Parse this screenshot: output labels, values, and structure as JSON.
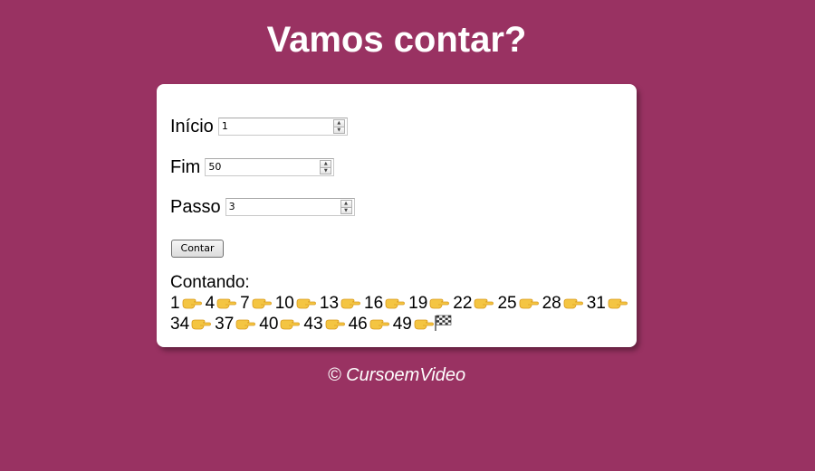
{
  "title": "Vamos contar?",
  "form": {
    "inicio": {
      "label": "Início",
      "value": "1"
    },
    "fim": {
      "label": "Fim",
      "value": "50"
    },
    "passo": {
      "label": "Passo",
      "value": "3"
    },
    "button_label": "Contar"
  },
  "result": {
    "heading": "Contando:",
    "numbers": [
      "1",
      "4",
      "7",
      "10",
      "13",
      "16",
      "19",
      "22",
      "25",
      "28",
      "31",
      "34",
      "37",
      "40",
      "43",
      "46",
      "49"
    ],
    "separator_icon": "pointing-hand-icon",
    "end_icon": "checkered-flag-icon"
  },
  "footer": "© CursoemVideo",
  "colors": {
    "background": "#993262",
    "card": "#ffffff",
    "text_light": "#ffffff"
  }
}
